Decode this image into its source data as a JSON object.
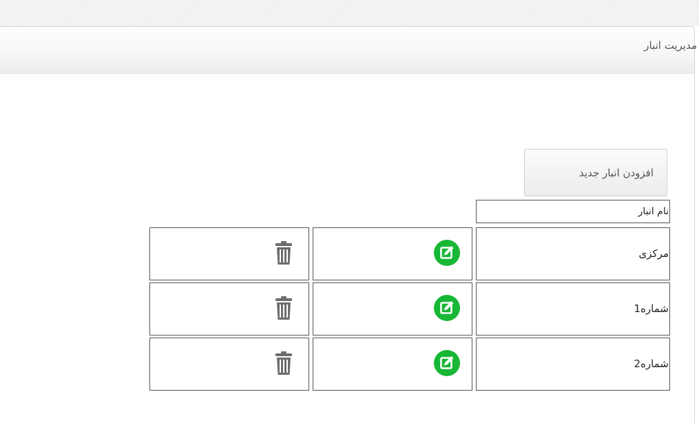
{
  "panel": {
    "title": "مدیریت انبار"
  },
  "toolbar": {
    "add_label": "افزودن انبار جدید"
  },
  "table": {
    "header": "نام انبار",
    "rows": [
      {
        "name": "مرکزی"
      },
      {
        "name": "شماره1"
      },
      {
        "name": "شماره2"
      }
    ]
  },
  "icons": {
    "edit": "edit-icon",
    "delete": "trash-icon"
  },
  "colors": {
    "edit_green": "#18b735",
    "trash_gray": "#6d6d6d"
  }
}
